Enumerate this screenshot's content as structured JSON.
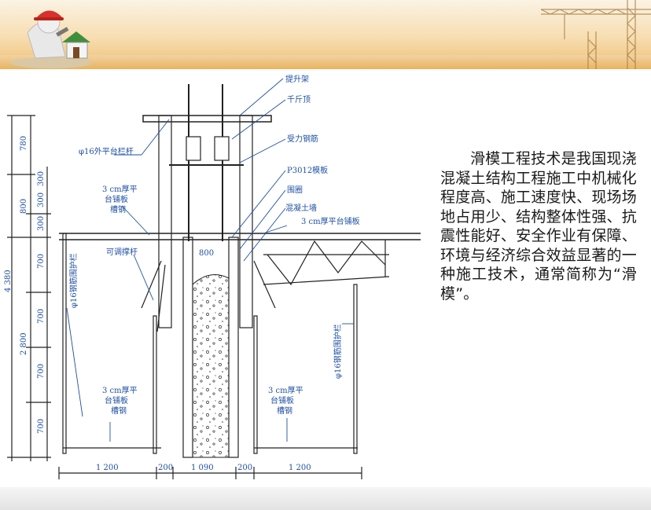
{
  "slide": {
    "body_text": "滑模工程技术是我国现浇混凝土结构工程施工中机械化程度高、施工速度快、现场场地占用少、结构整体性强、抗震性能好、安全作业有保障、环境与经济综合效益显著的一种施工技术，通常简称为“滑模”。"
  },
  "diagram": {
    "labels": {
      "lifting_frame": "提升架",
      "jack": "千斤顶",
      "stressed_rebar": "受力钢筋",
      "formwork": "P3012模板",
      "ring_beam": "围圈",
      "concrete_wall": "混凝土墙",
      "platform_board_right": "3 cm厚平台铺板",
      "outer_railing": "φ16外平台栏杆",
      "platform_board_left_1": "3 cm厚平",
      "platform_board_left_2": "台铺板",
      "channel_left": "槽钢",
      "adjustable_brace": "可调撑杆",
      "left_guard_rail": "φ16钢筋围护栏",
      "right_guard_rail": "φ16钢筋围护栏",
      "bottom_left_1": "3 cm厚平",
      "bottom_left_2": "台铺板",
      "bottom_left_3": "槽钢",
      "bottom_right_1": "3 cm厚平",
      "bottom_right_2": "台铺板",
      "bottom_right_3": "槽钢",
      "span_800": "800"
    },
    "vertical_dims": {
      "d780": "780",
      "d800": "800",
      "d300a": "300",
      "d300b": "300",
      "d300c": "300",
      "d4380": "4 380",
      "d2800": "2 800",
      "d700a": "700",
      "d700b": "700",
      "d700c": "700",
      "d700d": "700"
    },
    "horizontal_dims": {
      "h1200a": "1 200",
      "h200a": "200",
      "h1090": "1 090",
      "h200b": "200",
      "h1200b": "1 200"
    }
  }
}
